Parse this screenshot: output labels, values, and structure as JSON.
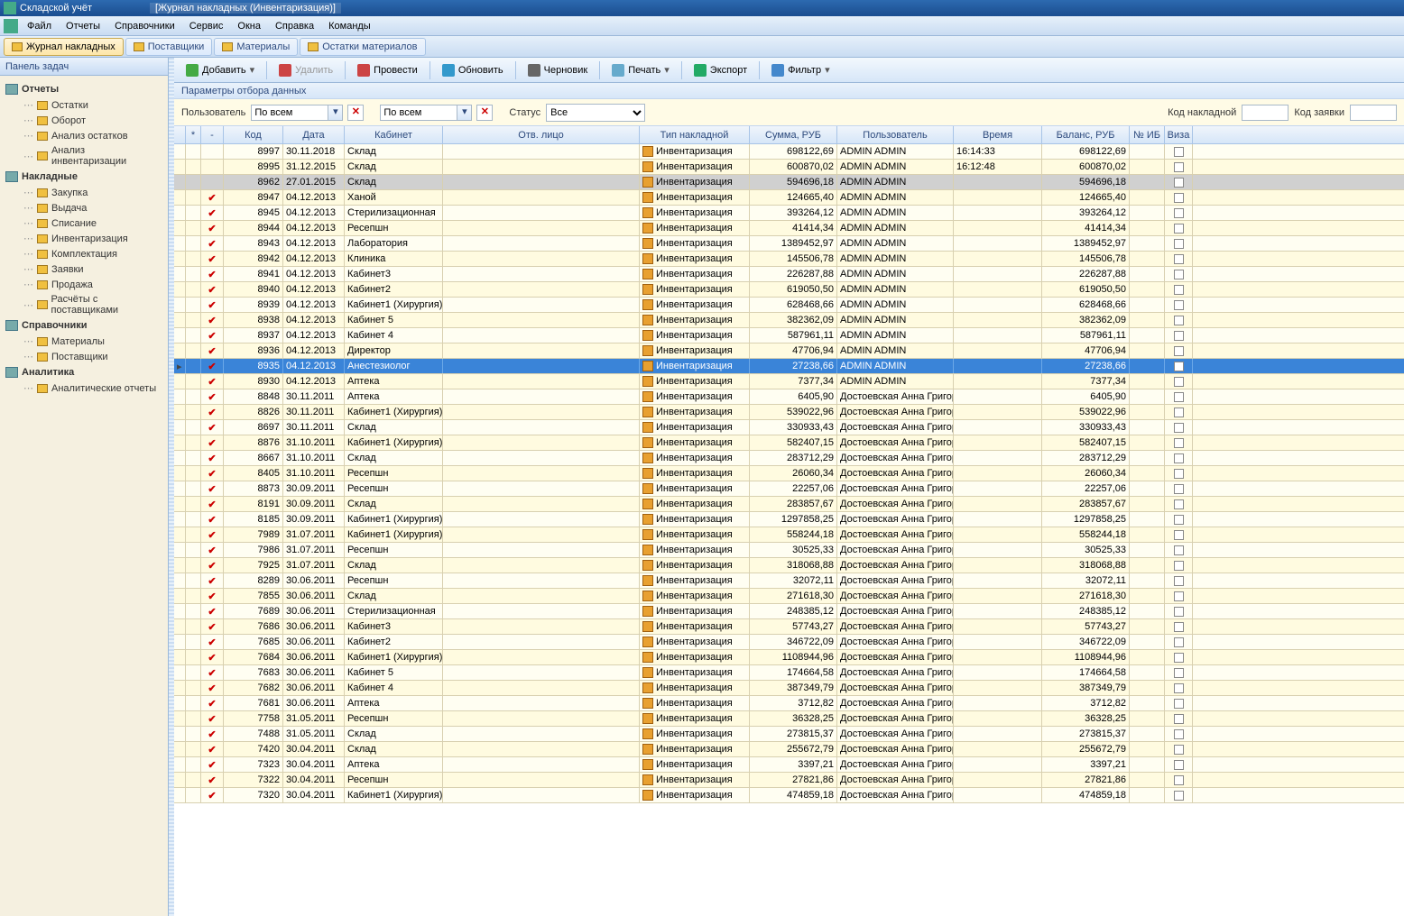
{
  "title": {
    "app": "Складской учёт",
    "doc": "[Журнал накладных (Инвентаризация)]"
  },
  "menu": [
    "Файл",
    "Отчеты",
    "Справочники",
    "Сервис",
    "Окна",
    "Справка",
    "Команды"
  ],
  "tabs": [
    {
      "label": "Журнал накладных",
      "active": true
    },
    {
      "label": "Поставщики",
      "active": false
    },
    {
      "label": "Материалы",
      "active": false
    },
    {
      "label": "Остатки материалов",
      "active": false
    }
  ],
  "sidebar": {
    "title": "Панель задач",
    "groups": [
      {
        "label": "Отчеты",
        "items": [
          "Остатки",
          "Оборот",
          "Анализ остатков",
          "Анализ инвентаризации"
        ]
      },
      {
        "label": "Накладные",
        "items": [
          "Закупка",
          "Выдача",
          "Списание",
          "Инвентаризация",
          "Комплектация",
          "Заявки",
          "Продажа",
          "Расчёты с поставщиками"
        ]
      },
      {
        "label": "Справочники",
        "items": [
          "Материалы",
          "Поставщики"
        ]
      },
      {
        "label": "Аналитика",
        "items": [
          "Аналитические отчеты"
        ]
      }
    ]
  },
  "toolbar": [
    {
      "label": "Добавить",
      "dd": true,
      "icon": "#4a4"
    },
    {
      "label": "Удалить",
      "disabled": true,
      "icon": "#c44"
    },
    {
      "label": "Провести",
      "icon": "#c44"
    },
    {
      "label": "Обновить",
      "icon": "#39c"
    },
    {
      "label": "Черновик",
      "icon": "#666"
    },
    {
      "label": "Печать",
      "dd": true,
      "icon": "#6ac"
    },
    {
      "label": "Экспорт",
      "icon": "#2a6"
    },
    {
      "label": "Фильтр",
      "dd": true,
      "icon": "#48c"
    }
  ],
  "filters": {
    "header": "Параметры отбора данных",
    "user_label": "Пользователь",
    "user_value": "По всем",
    "cab_value": "По всем",
    "status_label": "Статус",
    "status_value": "Все",
    "code_label": "Код накладной",
    "req_label": "Код заявки"
  },
  "columns": [
    "",
    "*",
    "-",
    "Код",
    "Дата",
    "Кабинет",
    "Отв. лицо",
    "Тип накладной",
    "Сумма, РУБ",
    "Пользователь",
    "Время",
    "Баланс, РУБ",
    "№ ИБ",
    "Виза"
  ],
  "type_label": "Инвентаризация",
  "rows": [
    {
      "c": "8997",
      "d": "30.11.2018",
      "cab": "Склад",
      "s": "698122,69",
      "u": "ADMIN ADMIN",
      "t": "16:14:33",
      "b": "698122,69",
      "chk": false
    },
    {
      "c": "8995",
      "d": "31.12.2015",
      "cab": "Склад",
      "s": "600870,02",
      "u": "ADMIN ADMIN",
      "t": "16:12:48",
      "b": "600870,02",
      "chk": false
    },
    {
      "c": "8962",
      "d": "27.01.2015",
      "cab": "Склад",
      "s": "594696,18",
      "u": "ADMIN ADMIN",
      "t": "",
      "b": "594696,18",
      "gray": true,
      "chk": false
    },
    {
      "c": "8947",
      "d": "04.12.2013",
      "cab": "Ханой",
      "s": "124665,40",
      "u": "ADMIN ADMIN",
      "t": "",
      "b": "124665,40"
    },
    {
      "c": "8945",
      "d": "04.12.2013",
      "cab": "Стерилизационная",
      "s": "393264,12",
      "u": "ADMIN ADMIN",
      "t": "",
      "b": "393264,12"
    },
    {
      "c": "8944",
      "d": "04.12.2013",
      "cab": "Ресепшн",
      "s": "41414,34",
      "u": "ADMIN ADMIN",
      "t": "",
      "b": "41414,34"
    },
    {
      "c": "8943",
      "d": "04.12.2013",
      "cab": "Лаборатория",
      "s": "1389452,97",
      "u": "ADMIN ADMIN",
      "t": "",
      "b": "1389452,97"
    },
    {
      "c": "8942",
      "d": "04.12.2013",
      "cab": "Клиника",
      "s": "145506,78",
      "u": "ADMIN ADMIN",
      "t": "",
      "b": "145506,78"
    },
    {
      "c": "8941",
      "d": "04.12.2013",
      "cab": "Кабинет3",
      "s": "226287,88",
      "u": "ADMIN ADMIN",
      "t": "",
      "b": "226287,88"
    },
    {
      "c": "8940",
      "d": "04.12.2013",
      "cab": "Кабинет2",
      "s": "619050,50",
      "u": "ADMIN ADMIN",
      "t": "",
      "b": "619050,50"
    },
    {
      "c": "8939",
      "d": "04.12.2013",
      "cab": "Кабинет1 (Хирургия)",
      "s": "628468,66",
      "u": "ADMIN ADMIN",
      "t": "",
      "b": "628468,66"
    },
    {
      "c": "8938",
      "d": "04.12.2013",
      "cab": "Кабинет 5",
      "s": "382362,09",
      "u": "ADMIN ADMIN",
      "t": "",
      "b": "382362,09"
    },
    {
      "c": "8937",
      "d": "04.12.2013",
      "cab": "Кабинет 4",
      "s": "587961,11",
      "u": "ADMIN ADMIN",
      "t": "",
      "b": "587961,11"
    },
    {
      "c": "8936",
      "d": "04.12.2013",
      "cab": "Директор",
      "s": "47706,94",
      "u": "ADMIN ADMIN",
      "t": "",
      "b": "47706,94"
    },
    {
      "c": "8935",
      "d": "04.12.2013",
      "cab": "Анестезиолог",
      "s": "27238,66",
      "u": "ADMIN ADMIN",
      "t": "",
      "b": "27238,66",
      "sel": true
    },
    {
      "c": "8930",
      "d": "04.12.2013",
      "cab": "Аптека",
      "s": "7377,34",
      "u": "ADMIN ADMIN",
      "t": "",
      "b": "7377,34"
    },
    {
      "c": "8848",
      "d": "30.11.2011",
      "cab": "Аптека",
      "s": "6405,90",
      "u": "Достоевская Анна Григорь",
      "t": "",
      "b": "6405,90"
    },
    {
      "c": "8826",
      "d": "30.11.2011",
      "cab": "Кабинет1 (Хирургия)",
      "s": "539022,96",
      "u": "Достоевская Анна Григорь",
      "t": "",
      "b": "539022,96"
    },
    {
      "c": "8697",
      "d": "30.11.2011",
      "cab": "Склад",
      "s": "330933,43",
      "u": "Достоевская Анна Григорь",
      "t": "",
      "b": "330933,43"
    },
    {
      "c": "8876",
      "d": "31.10.2011",
      "cab": "Кабинет1 (Хирургия)",
      "s": "582407,15",
      "u": "Достоевская Анна Григорь",
      "t": "",
      "b": "582407,15"
    },
    {
      "c": "8667",
      "d": "31.10.2011",
      "cab": "Склад",
      "s": "283712,29",
      "u": "Достоевская Анна Григорь",
      "t": "",
      "b": "283712,29"
    },
    {
      "c": "8405",
      "d": "31.10.2011",
      "cab": "Ресепшн",
      "s": "26060,34",
      "u": "Достоевская Анна Григорь",
      "t": "",
      "b": "26060,34"
    },
    {
      "c": "8873",
      "d": "30.09.2011",
      "cab": "Ресепшн",
      "s": "22257,06",
      "u": "Достоевская Анна Григорь",
      "t": "",
      "b": "22257,06"
    },
    {
      "c": "8191",
      "d": "30.09.2011",
      "cab": "Склад",
      "s": "283857,67",
      "u": "Достоевская Анна Григорь",
      "t": "",
      "b": "283857,67"
    },
    {
      "c": "8185",
      "d": "30.09.2011",
      "cab": "Кабинет1 (Хирургия)",
      "s": "1297858,25",
      "u": "Достоевская Анна Григорь",
      "t": "",
      "b": "1297858,25"
    },
    {
      "c": "7989",
      "d": "31.07.2011",
      "cab": "Кабинет1 (Хирургия)",
      "s": "558244,18",
      "u": "Достоевская Анна Григорь",
      "t": "",
      "b": "558244,18"
    },
    {
      "c": "7986",
      "d": "31.07.2011",
      "cab": "Ресепшн",
      "s": "30525,33",
      "u": "Достоевская Анна Григорь",
      "t": "",
      "b": "30525,33"
    },
    {
      "c": "7925",
      "d": "31.07.2011",
      "cab": "Склад",
      "s": "318068,88",
      "u": "Достоевская Анна Григорь",
      "t": "",
      "b": "318068,88"
    },
    {
      "c": "8289",
      "d": "30.06.2011",
      "cab": "Ресепшн",
      "s": "32072,11",
      "u": "Достоевская Анна Григорь",
      "t": "",
      "b": "32072,11"
    },
    {
      "c": "7855",
      "d": "30.06.2011",
      "cab": "Склад",
      "s": "271618,30",
      "u": "Достоевская Анна Григорь",
      "t": "",
      "b": "271618,30"
    },
    {
      "c": "7689",
      "d": "30.06.2011",
      "cab": "Стерилизационная",
      "s": "248385,12",
      "u": "Достоевская Анна Григорь",
      "t": "",
      "b": "248385,12"
    },
    {
      "c": "7686",
      "d": "30.06.2011",
      "cab": "Кабинет3",
      "s": "57743,27",
      "u": "Достоевская Анна Григорь",
      "t": "",
      "b": "57743,27"
    },
    {
      "c": "7685",
      "d": "30.06.2011",
      "cab": "Кабинет2",
      "s": "346722,09",
      "u": "Достоевская Анна Григорь",
      "t": "",
      "b": "346722,09"
    },
    {
      "c": "7684",
      "d": "30.06.2011",
      "cab": "Кабинет1 (Хирургия)",
      "s": "1108944,96",
      "u": "Достоевская Анна Григорь",
      "t": "",
      "b": "1108944,96"
    },
    {
      "c": "7683",
      "d": "30.06.2011",
      "cab": "Кабинет 5",
      "s": "174664,58",
      "u": "Достоевская Анна Григорь",
      "t": "",
      "b": "174664,58"
    },
    {
      "c": "7682",
      "d": "30.06.2011",
      "cab": "Кабинет 4",
      "s": "387349,79",
      "u": "Достоевская Анна Григорь",
      "t": "",
      "b": "387349,79"
    },
    {
      "c": "7681",
      "d": "30.06.2011",
      "cab": "Аптека",
      "s": "3712,82",
      "u": "Достоевская Анна Григорь",
      "t": "",
      "b": "3712,82"
    },
    {
      "c": "7758",
      "d": "31.05.2011",
      "cab": "Ресепшн",
      "s": "36328,25",
      "u": "Достоевская Анна Григорь",
      "t": "",
      "b": "36328,25"
    },
    {
      "c": "7488",
      "d": "31.05.2011",
      "cab": "Склад",
      "s": "273815,37",
      "u": "Достоевская Анна Григорь",
      "t": "",
      "b": "273815,37"
    },
    {
      "c": "7420",
      "d": "30.04.2011",
      "cab": "Склад",
      "s": "255672,79",
      "u": "Достоевская Анна Григорь",
      "t": "",
      "b": "255672,79"
    },
    {
      "c": "7323",
      "d": "30.04.2011",
      "cab": "Аптека",
      "s": "3397,21",
      "u": "Достоевская Анна Григорь",
      "t": "",
      "b": "3397,21"
    },
    {
      "c": "7322",
      "d": "30.04.2011",
      "cab": "Ресепшн",
      "s": "27821,86",
      "u": "Достоевская Анна Григорь",
      "t": "",
      "b": "27821,86"
    },
    {
      "c": "7320",
      "d": "30.04.2011",
      "cab": "Кабинет1 (Хирургия)",
      "s": "474859,18",
      "u": "Достоевская Анна Григорь",
      "t": "",
      "b": "474859,18"
    }
  ]
}
